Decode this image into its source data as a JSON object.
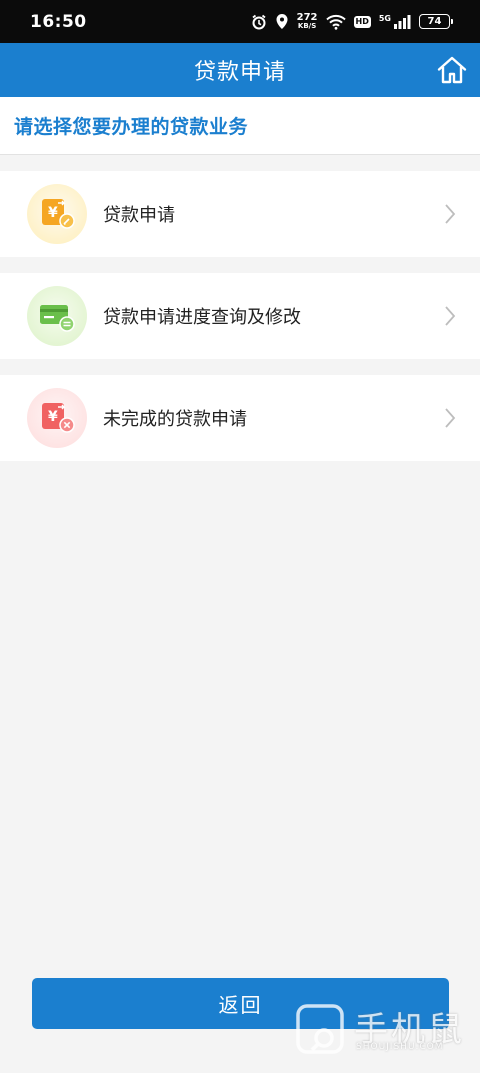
{
  "status_bar": {
    "time": "16:50",
    "net_speed_value": "272",
    "net_speed_unit": "KB/S",
    "hd_label": "HD",
    "network_type": "5G",
    "battery_level": "74"
  },
  "header": {
    "title": "贷款申请",
    "home_icon": "home-icon"
  },
  "prompt": {
    "text": "请选择您要办理的贷款业务"
  },
  "menu": {
    "items": [
      {
        "label": "贷款申请",
        "icon": "yuan-edit-icon",
        "icon_color": "#f5a623",
        "bg_color": "#fdf0c4"
      },
      {
        "label": "贷款申请进度查询及修改",
        "icon": "card-exchange-icon",
        "icon_color": "#6abf4b",
        "bg_color": "#e4f5d4"
      },
      {
        "label": "未完成的贷款申请",
        "icon": "yuan-cancel-icon",
        "icon_color": "#f06262",
        "bg_color": "#fde2e2"
      }
    ]
  },
  "footer": {
    "return_label": "返回"
  },
  "watermark": {
    "main": "手机鼠",
    "sub": "SHOUJISHU.COM"
  },
  "colors": {
    "primary": "#1b7fcf",
    "background": "#f4f4f4"
  }
}
